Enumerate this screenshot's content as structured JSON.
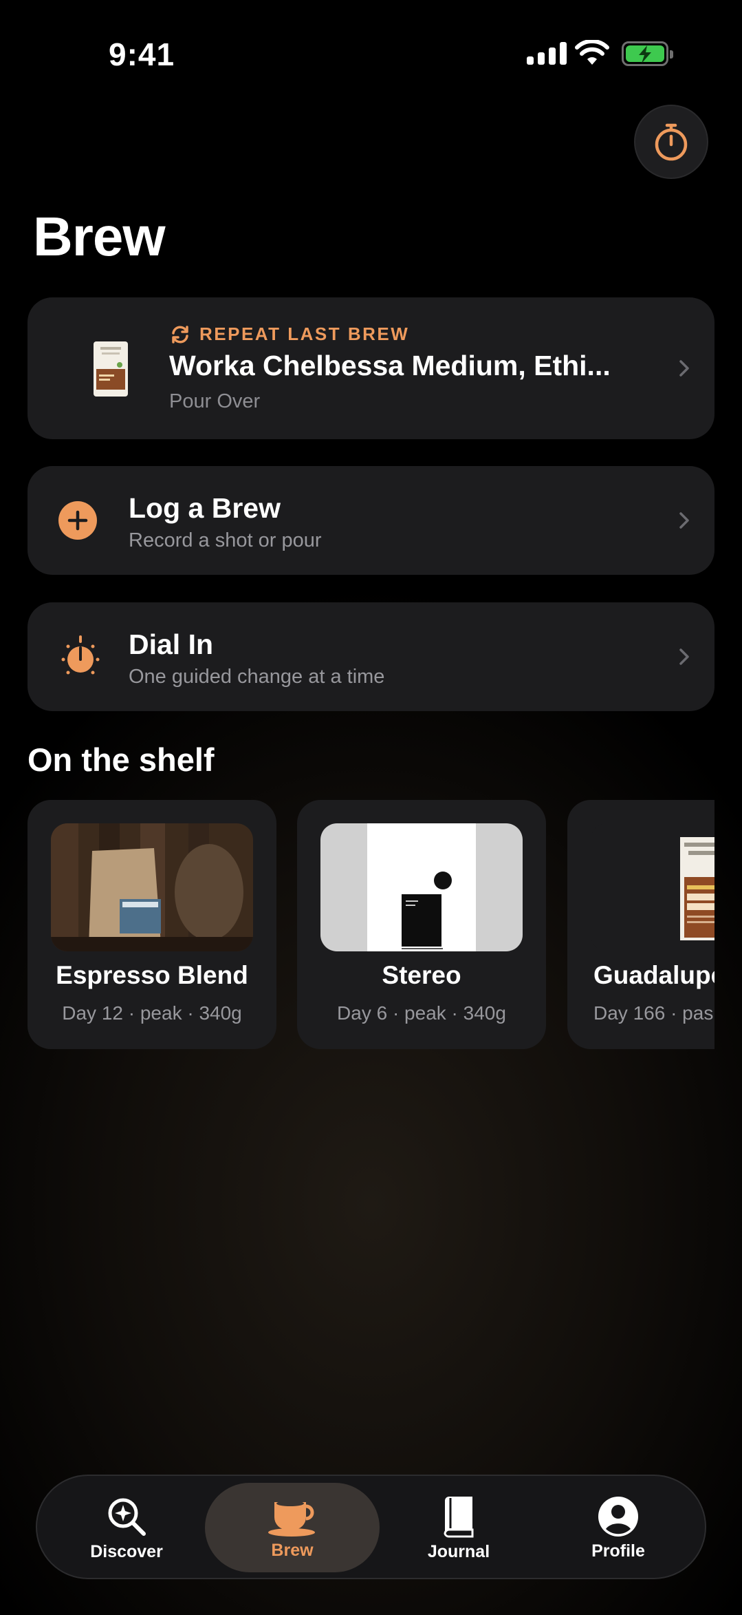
{
  "status_bar": {
    "time": "9:41"
  },
  "header": {
    "title": "Brew"
  },
  "repeat_card": {
    "kicker": "REPEAT LAST BREW",
    "title": "Worka Chelbessa Medium, Ethi...",
    "method": "Pour Over"
  },
  "actions": [
    {
      "title": "Log a Brew",
      "subtitle": "Record a shot or pour",
      "icon": "plus-circle-icon"
    },
    {
      "title": "Dial In",
      "subtitle": "One guided change at a time",
      "icon": "dial-in-icon"
    }
  ],
  "shelf": {
    "title": "On the shelf",
    "beans": [
      {
        "name": "Espresso Blend",
        "meta": "Day 12 · peak · 340g"
      },
      {
        "name": "Stereo",
        "meta": "Day 6 · peak · 340g"
      },
      {
        "name": "Guadalupe",
        "meta": "Day 166 · pas"
      }
    ]
  },
  "tabbar": {
    "items": [
      {
        "label": "Discover",
        "icon": "discover-icon"
      },
      {
        "label": "Brew",
        "icon": "coffee-cup-icon",
        "active": true
      },
      {
        "label": "Journal",
        "icon": "book-icon"
      },
      {
        "label": "Profile",
        "icon": "person-icon"
      }
    ]
  },
  "colors": {
    "accent": "#ee9a5c",
    "card": "#1c1c1e",
    "secondary_text": "#98989d"
  }
}
